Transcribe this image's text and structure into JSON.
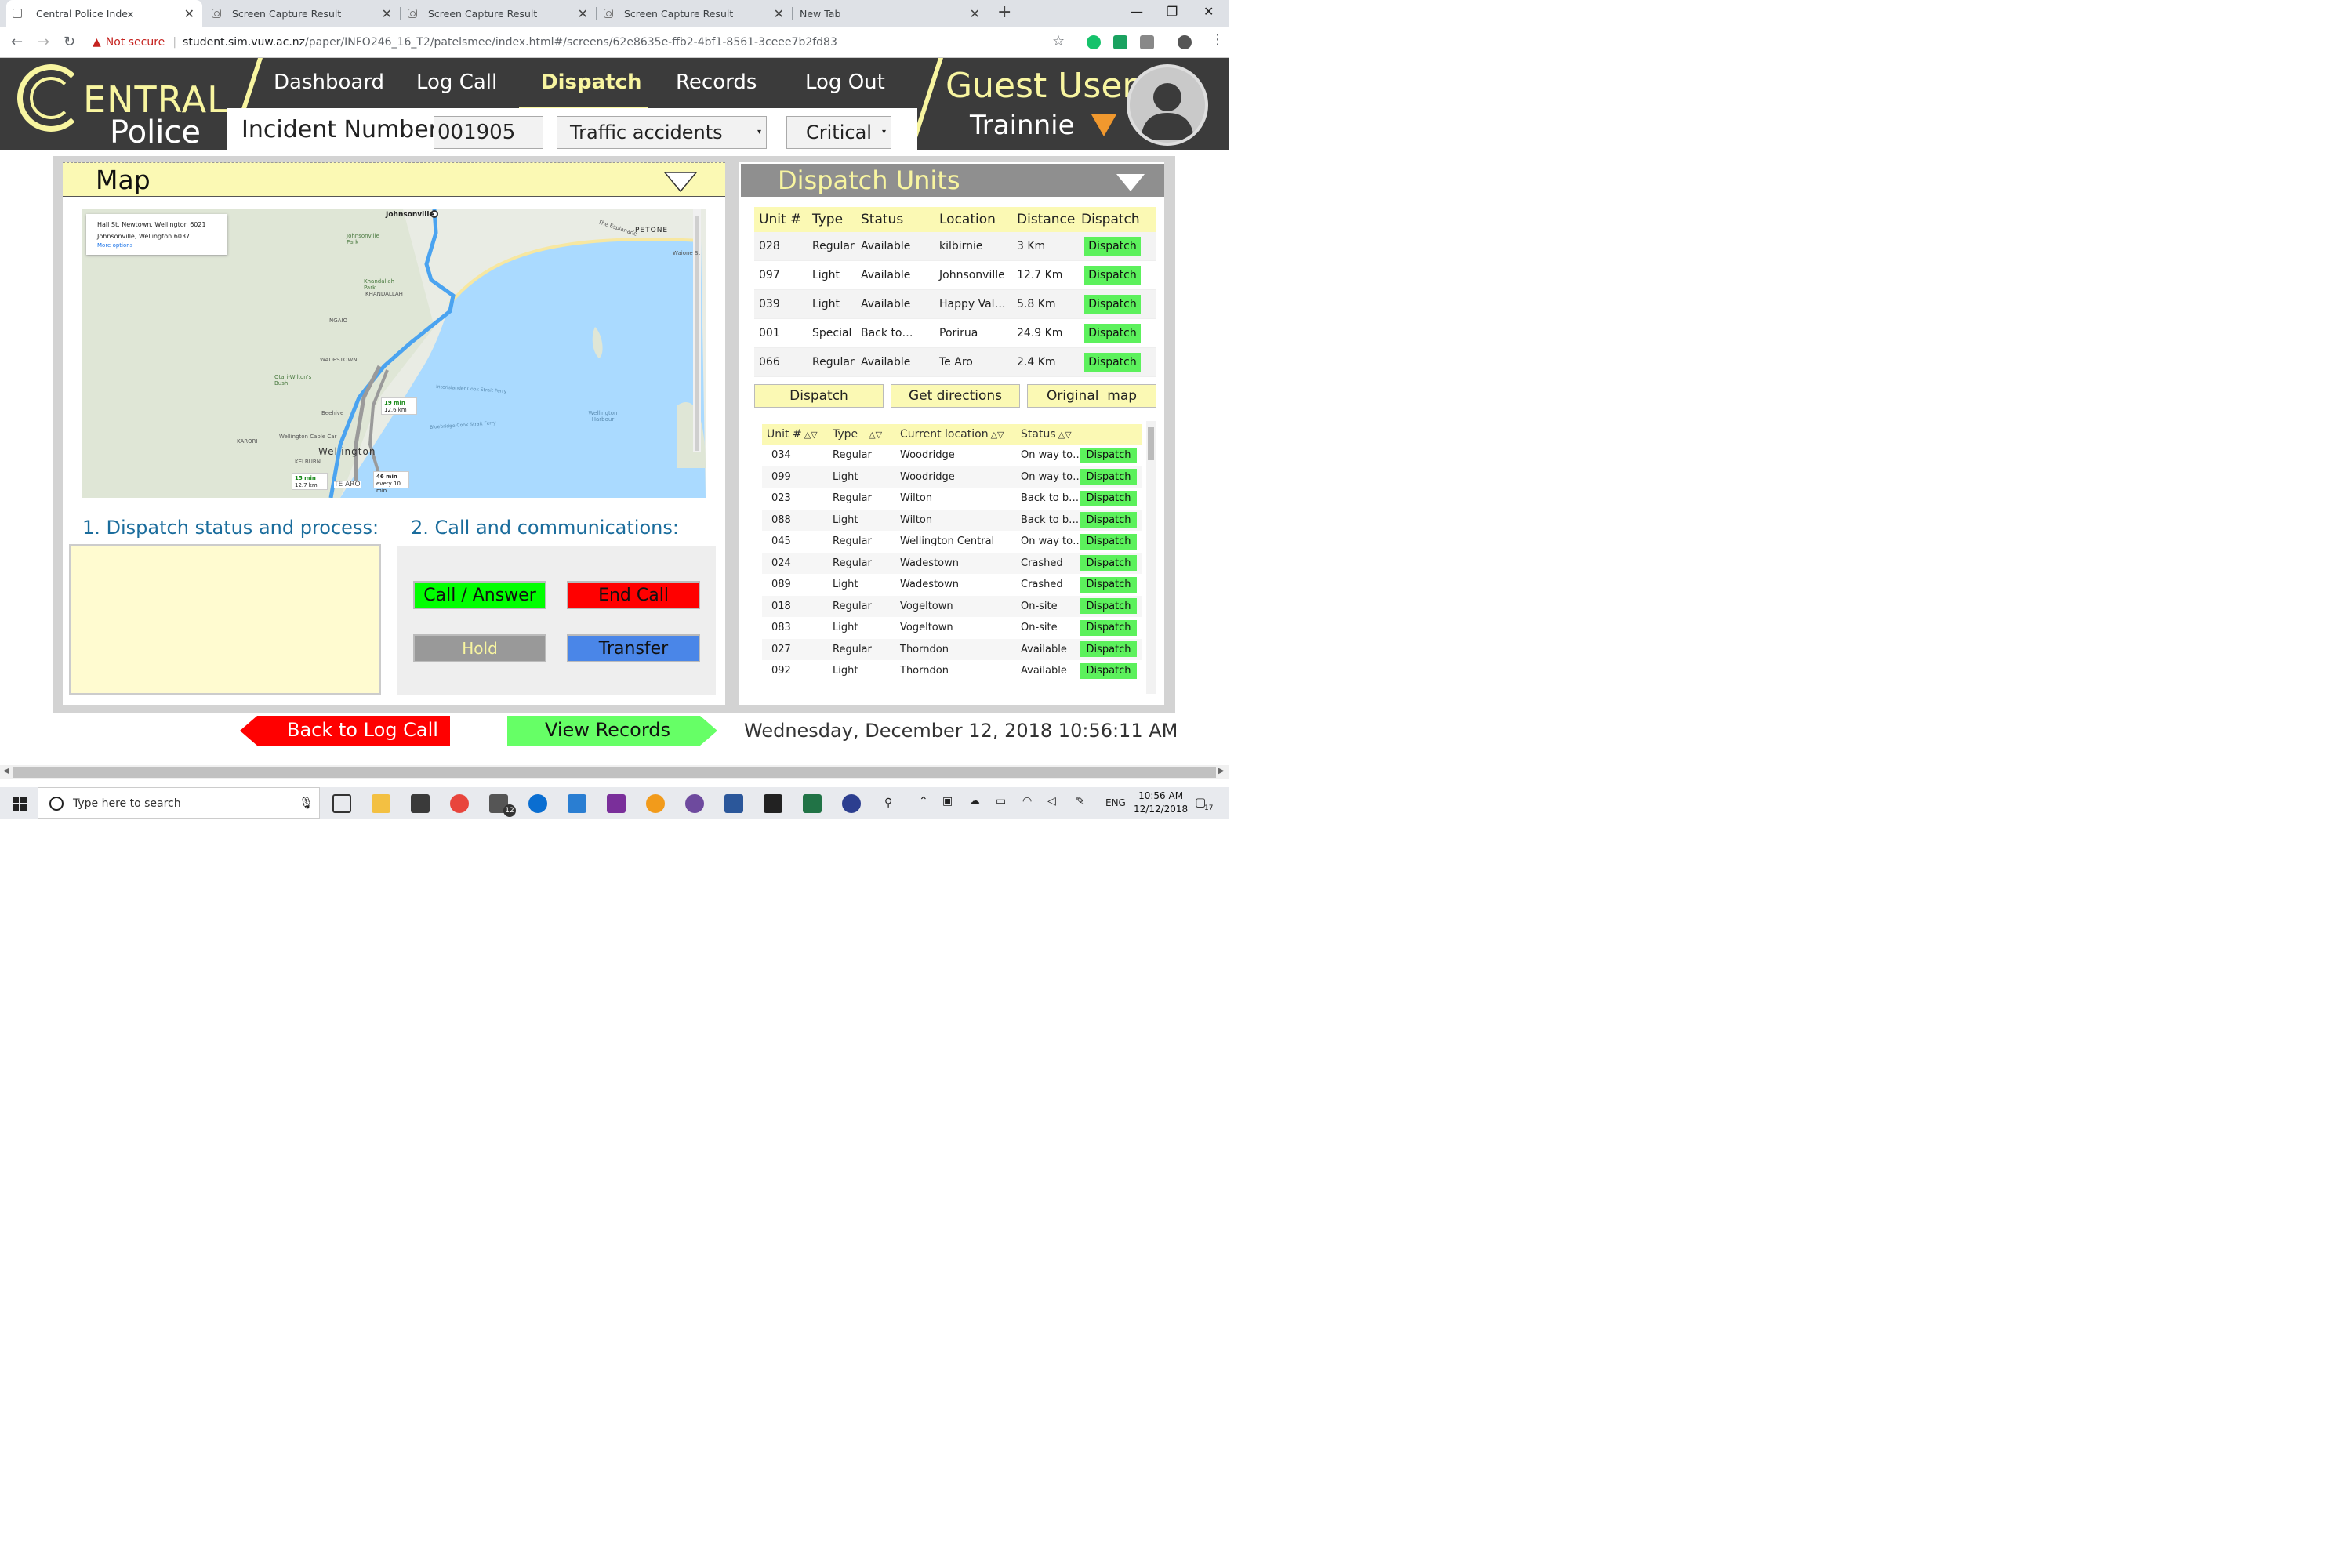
{
  "browser": {
    "tabs": [
      {
        "title": "Central Police Index",
        "active": true
      },
      {
        "title": "Screen Capture Result",
        "active": false
      },
      {
        "title": "Screen Capture Result",
        "active": false
      },
      {
        "title": "Screen Capture Result",
        "active": false
      },
      {
        "title": "New Tab",
        "active": false
      }
    ],
    "new_tab_glyph": "+",
    "not_secure": "Not secure",
    "url_host": "student.sim.vuw.ac.nz",
    "url_path": "/paper/INFO246_16_T2/patelsmee/index.html#/screens/62e8635e-ffb2-4bf1-8561-3ceee7b2fd83",
    "window_controls": [
      "—",
      "❐",
      "✕"
    ]
  },
  "header": {
    "logo_c": "C",
    "logo_entral": "ENTRAL",
    "logo_police": "Police",
    "nav": [
      {
        "label": "Dashboard",
        "active": false
      },
      {
        "label": "Log Call",
        "active": false
      },
      {
        "label": "Dispatch",
        "active": true
      },
      {
        "label": "Records",
        "active": false
      },
      {
        "label": "Log Out",
        "active": false
      }
    ],
    "incident_label": "Incident Number:",
    "incident_value": "001905",
    "incident_type": "Traffic accidents",
    "priority": "Critical",
    "user_name": "Guest User",
    "user_role": "Trainnie"
  },
  "map_panel": {
    "title": "Map",
    "route_from": "Hall St, Newtown, Wellington 6021",
    "route_to": "Johnsonville, Wellington 6037",
    "more_options": "More options",
    "places": [
      "Johnsonville",
      "PETONE",
      "The Esplanade",
      "Waione St",
      "Johnsonville Park",
      "Khandallah Park",
      "KHANDALLAH",
      "NGAIO",
      "WADESTOWN",
      "Otari-Wilton's Bush",
      "Interislander Cook Strait Ferry",
      "Bluebridge Cook Strait Ferry",
      "Wellington Harbour",
      "Wellington Cable Car",
      "KARORI",
      "Wellington",
      "KELBURN",
      "TE ARO",
      "Beehive"
    ],
    "route_times": [
      {
        "time": "19 min",
        "dist": "12.6 km"
      },
      {
        "time": "15 min",
        "dist": "12.7 km"
      },
      {
        "time": "46 min",
        "dist": "every 10 min"
      }
    ],
    "section1_title": "1. Dispatch status and process:",
    "section2_title": "2. Call and communications:",
    "comm_buttons": {
      "call": "Call / Answer",
      "end": "End Call",
      "hold": "Hold",
      "transfer": "Transfer"
    }
  },
  "units_panel": {
    "title": "Dispatch Units",
    "columns": [
      "Unit #",
      "Type",
      "Status",
      "Location",
      "Distance",
      "Dispatch"
    ],
    "rows": [
      {
        "unit": "028",
        "type": "Regular",
        "status": "Available",
        "location": "kilbirnie",
        "distance": "3 Km"
      },
      {
        "unit": "097",
        "type": "Light",
        "status": "Available",
        "location": "Johnsonville",
        "distance": "12.7 Km"
      },
      {
        "unit": "039",
        "type": "Light",
        "status": "Available",
        "location": "Happy Val…",
        "distance": "5.8 Km"
      },
      {
        "unit": "001",
        "type": "Special",
        "status": "Back to…",
        "location": "Porirua",
        "distance": "24.9 Km"
      },
      {
        "unit": "066",
        "type": "Regular",
        "status": "Available",
        "location": "Te Aro",
        "distance": "2.4 Km"
      }
    ],
    "dispatch_label": "Dispatch",
    "actions": {
      "dispatch": "Dispatch",
      "directions": "Get directions",
      "original_map": "Original  map"
    },
    "list_columns": [
      "Unit #",
      "Type",
      "Current location",
      "Status"
    ],
    "list_rows": [
      {
        "unit": "034",
        "type": "Regular",
        "location": "Woodridge",
        "status": "On way to…"
      },
      {
        "unit": "099",
        "type": "Light",
        "location": "Woodridge",
        "status": "On way to…"
      },
      {
        "unit": "023",
        "type": "Regular",
        "location": "Wilton",
        "status": "Back to b…"
      },
      {
        "unit": "088",
        "type": "Light",
        "location": "Wilton",
        "status": "Back to b…"
      },
      {
        "unit": "045",
        "type": "Regular",
        "location": "Wellington Central",
        "status": "On way to…"
      },
      {
        "unit": "024",
        "type": "Regular",
        "location": "Wadestown",
        "status": "Crashed"
      },
      {
        "unit": "089",
        "type": "Light",
        "location": "Wadestown",
        "status": "Crashed"
      },
      {
        "unit": "018",
        "type": "Regular",
        "location": "Vogeltown",
        "status": "On-site"
      },
      {
        "unit": "083",
        "type": "Light",
        "location": "Vogeltown",
        "status": "On-site"
      },
      {
        "unit": "027",
        "type": "Regular",
        "location": "Thorndon",
        "status": "Available"
      },
      {
        "unit": "092",
        "type": "Light",
        "location": "Thorndon",
        "status": "Available"
      }
    ]
  },
  "footer": {
    "back": "Back to Log Call",
    "view": "View Records",
    "datetime": "Wednesday, December 12, 2018 10:56:11 AM"
  },
  "taskbar": {
    "search_placeholder": "Type here to search",
    "mail_badge": "12",
    "language": "ENG",
    "time": "10:56 AM",
    "date": "12/12/2018",
    "notif_count": "17"
  },
  "colors": {
    "accent_yellow": "#f8f5a0",
    "panel_yellow": "#fbf9b4",
    "dark_header": "#3b3b3b",
    "dispatch_green": "#5cf15c",
    "end_red": "#ff0000",
    "transfer_blue": "#4a86e8",
    "title_blue": "#1a6c9c"
  }
}
